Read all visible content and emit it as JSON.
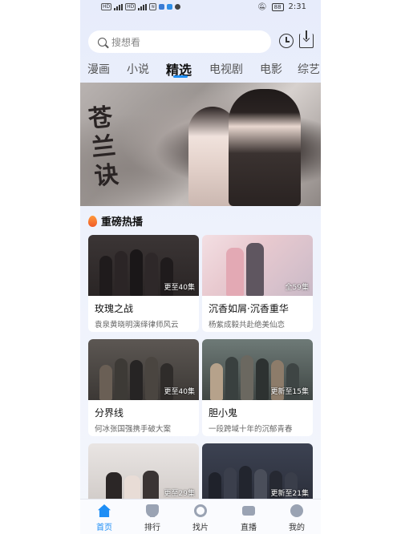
{
  "status": {
    "time": "2:31",
    "battery": "88"
  },
  "search": {
    "placeholder": "搜想看"
  },
  "tabs": [
    {
      "label": "漫画"
    },
    {
      "label": "小说"
    },
    {
      "label": "精选"
    },
    {
      "label": "电视剧"
    },
    {
      "label": "电影"
    },
    {
      "label": "综艺"
    }
  ],
  "banner": {
    "title": "苍兰诀"
  },
  "section": {
    "title": "重磅热播"
  },
  "cards": [
    {
      "title": "玫瑰之战",
      "sub": "袁泉黄晓明演绎律师风云",
      "episode": "更至40集"
    },
    {
      "title": "沉香如屑·沉香重华",
      "sub": "杨紫成毅共赴绝美仙恋",
      "episode": "全59集"
    },
    {
      "title": "分界线",
      "sub": "何冰张国强携手破大案",
      "episode": "更至40集"
    },
    {
      "title": "胆小鬼",
      "sub": "一段跨域十年的沉郁青春",
      "episode": "更新至15集"
    },
    {
      "title": "",
      "sub": "",
      "episode": "更至29集"
    },
    {
      "title": "",
      "sub": "",
      "episode": "更新至21集"
    }
  ],
  "nav": [
    {
      "label": "首页",
      "icon": "home-icon"
    },
    {
      "label": "排行",
      "icon": "trophy-icon"
    },
    {
      "label": "找片",
      "icon": "find-icon"
    },
    {
      "label": "直播",
      "icon": "live-icon"
    },
    {
      "label": "我的",
      "icon": "profile-icon"
    }
  ],
  "colors": {
    "accent": "#1e8ef5"
  }
}
